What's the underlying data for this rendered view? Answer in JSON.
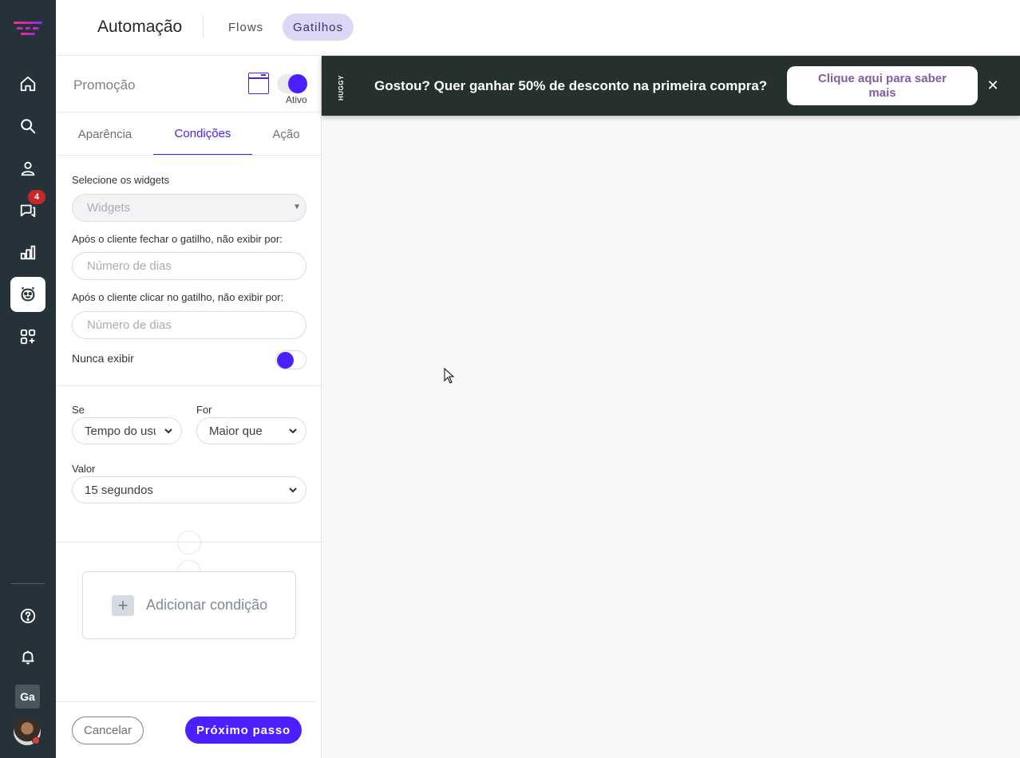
{
  "header": {
    "title": "Automação",
    "tabs": [
      {
        "label": "Flows",
        "active": false
      },
      {
        "label": "Gatilhos",
        "active": true
      }
    ]
  },
  "sidebar": {
    "items": [
      {
        "icon": "home-icon",
        "active": false
      },
      {
        "icon": "search-icon",
        "active": false
      },
      {
        "icon": "user-icon",
        "active": false
      },
      {
        "icon": "chat-icon",
        "active": false,
        "badge": "4"
      },
      {
        "icon": "chart-icon",
        "active": false
      },
      {
        "icon": "bot-icon",
        "active": true
      },
      {
        "icon": "apps-add-icon",
        "active": false
      },
      {
        "icon": "help-icon",
        "active": false
      },
      {
        "icon": "bell-icon",
        "active": false
      }
    ],
    "workspace_initials": "Ga",
    "accent": "#e0218a"
  },
  "panel": {
    "title": "Promoção",
    "toggle_label": "Ativo",
    "tabs": [
      {
        "label": "Aparência",
        "active": false
      },
      {
        "label": "Condições",
        "active": true
      },
      {
        "label": "Ação",
        "active": false
      }
    ],
    "widgets_label": "Selecione os widgets",
    "widgets_value": "Widgets",
    "close_label": "Após o cliente fechar o gatilho, não exibir por:",
    "close_placeholder": "Número de dias",
    "click_label": "Após o cliente clicar no gatilho, não exibir por:",
    "click_placeholder": "Número de dias",
    "never_label": "Nunca exibir",
    "se_label": "Se",
    "se_value": "Tempo do usuário",
    "for_label": "For",
    "for_value": "Maior que",
    "valor_label": "Valor",
    "valor_value": "15 segundos",
    "add_condition": "Adicionar condição",
    "cancel": "Cancelar",
    "next": "Próximo passo"
  },
  "banner": {
    "brand": "HUGGY",
    "text": "Gostou? Quer ganhar 50% de desconto na primeira compra?",
    "cta": "Clique aqui para saber mais",
    "close": "✕"
  },
  "colors": {
    "primary": "#4b1fff",
    "sidebar_bg": "#26323a",
    "banner_bg": "#25302f",
    "badge": "#c62828"
  }
}
